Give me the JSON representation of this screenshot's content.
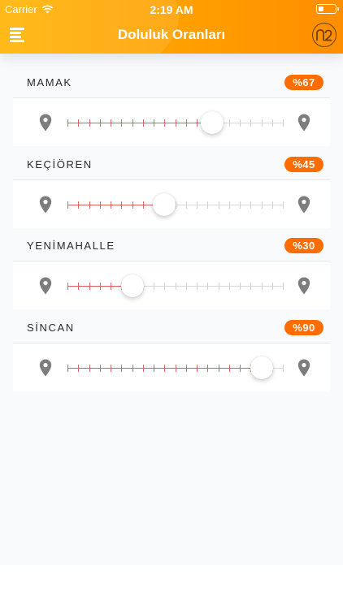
{
  "status_bar": {
    "carrier": "Carrier",
    "time": "2:19 AM",
    "icons": [
      "wifi-icon",
      "battery-icon"
    ]
  },
  "header": {
    "title": "Doluluk Oranları",
    "menu_icon": "hamburger-menu-icon",
    "logo_icon": "n2-logo-icon"
  },
  "colors": {
    "header_start": "#ffb300",
    "header_end": "#ff8d00",
    "badge": "#ff6d00",
    "track_active": "#e06060",
    "track_inactive": "#dadada",
    "pin": "#7d7d7d"
  },
  "districts": [
    {
      "name": "MAMAK",
      "badge": "%67",
      "value": 0.67
    },
    {
      "name": "KEÇİÖREN",
      "badge": "%45",
      "value": 0.45
    },
    {
      "name": "YENİMAHALLE",
      "badge": "%30",
      "value": 0.3
    },
    {
      "name": "SİNCAN",
      "badge": "%90",
      "value": 0.9
    }
  ]
}
